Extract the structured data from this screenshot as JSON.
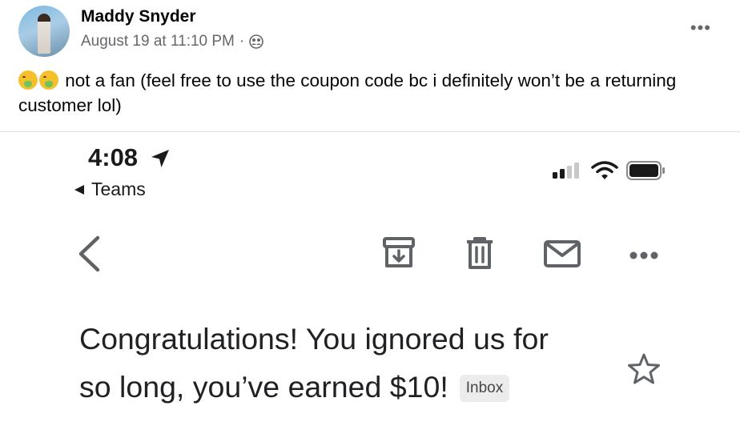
{
  "post": {
    "author": "Maddy Snyder",
    "timestamp": "August 19 at 11:10 PM",
    "separator": "·",
    "audience_icon": "friends-icon",
    "more_icon": "more-horizontal-icon",
    "text": "not a fan (feel free to use the coupon code bc i definitely won’t be a returning customer lol)",
    "emojis": [
      "nauseated-face-emoji",
      "nauseated-face-emoji"
    ]
  },
  "screenshot": {
    "status_bar": {
      "time": "4:08",
      "back_app": "Teams",
      "icons": [
        "location-arrow-icon",
        "signal-icon",
        "wifi-icon",
        "battery-icon"
      ]
    },
    "toolbar": {
      "icons": [
        "back-chevron-icon",
        "archive-icon",
        "trash-icon",
        "mail-icon",
        "more-horizontal-icon"
      ]
    },
    "email": {
      "subject_line1": "Congratulations! You ignored us for",
      "subject_line2": "so long, you’ve earned $10!",
      "label": "Inbox",
      "star_icon": "star-outline-icon"
    }
  },
  "colors": {
    "text_primary": "#050505",
    "text_secondary": "#65676b",
    "divider": "#dadde1",
    "email_text": "#202124",
    "chip_bg": "#ececec"
  }
}
